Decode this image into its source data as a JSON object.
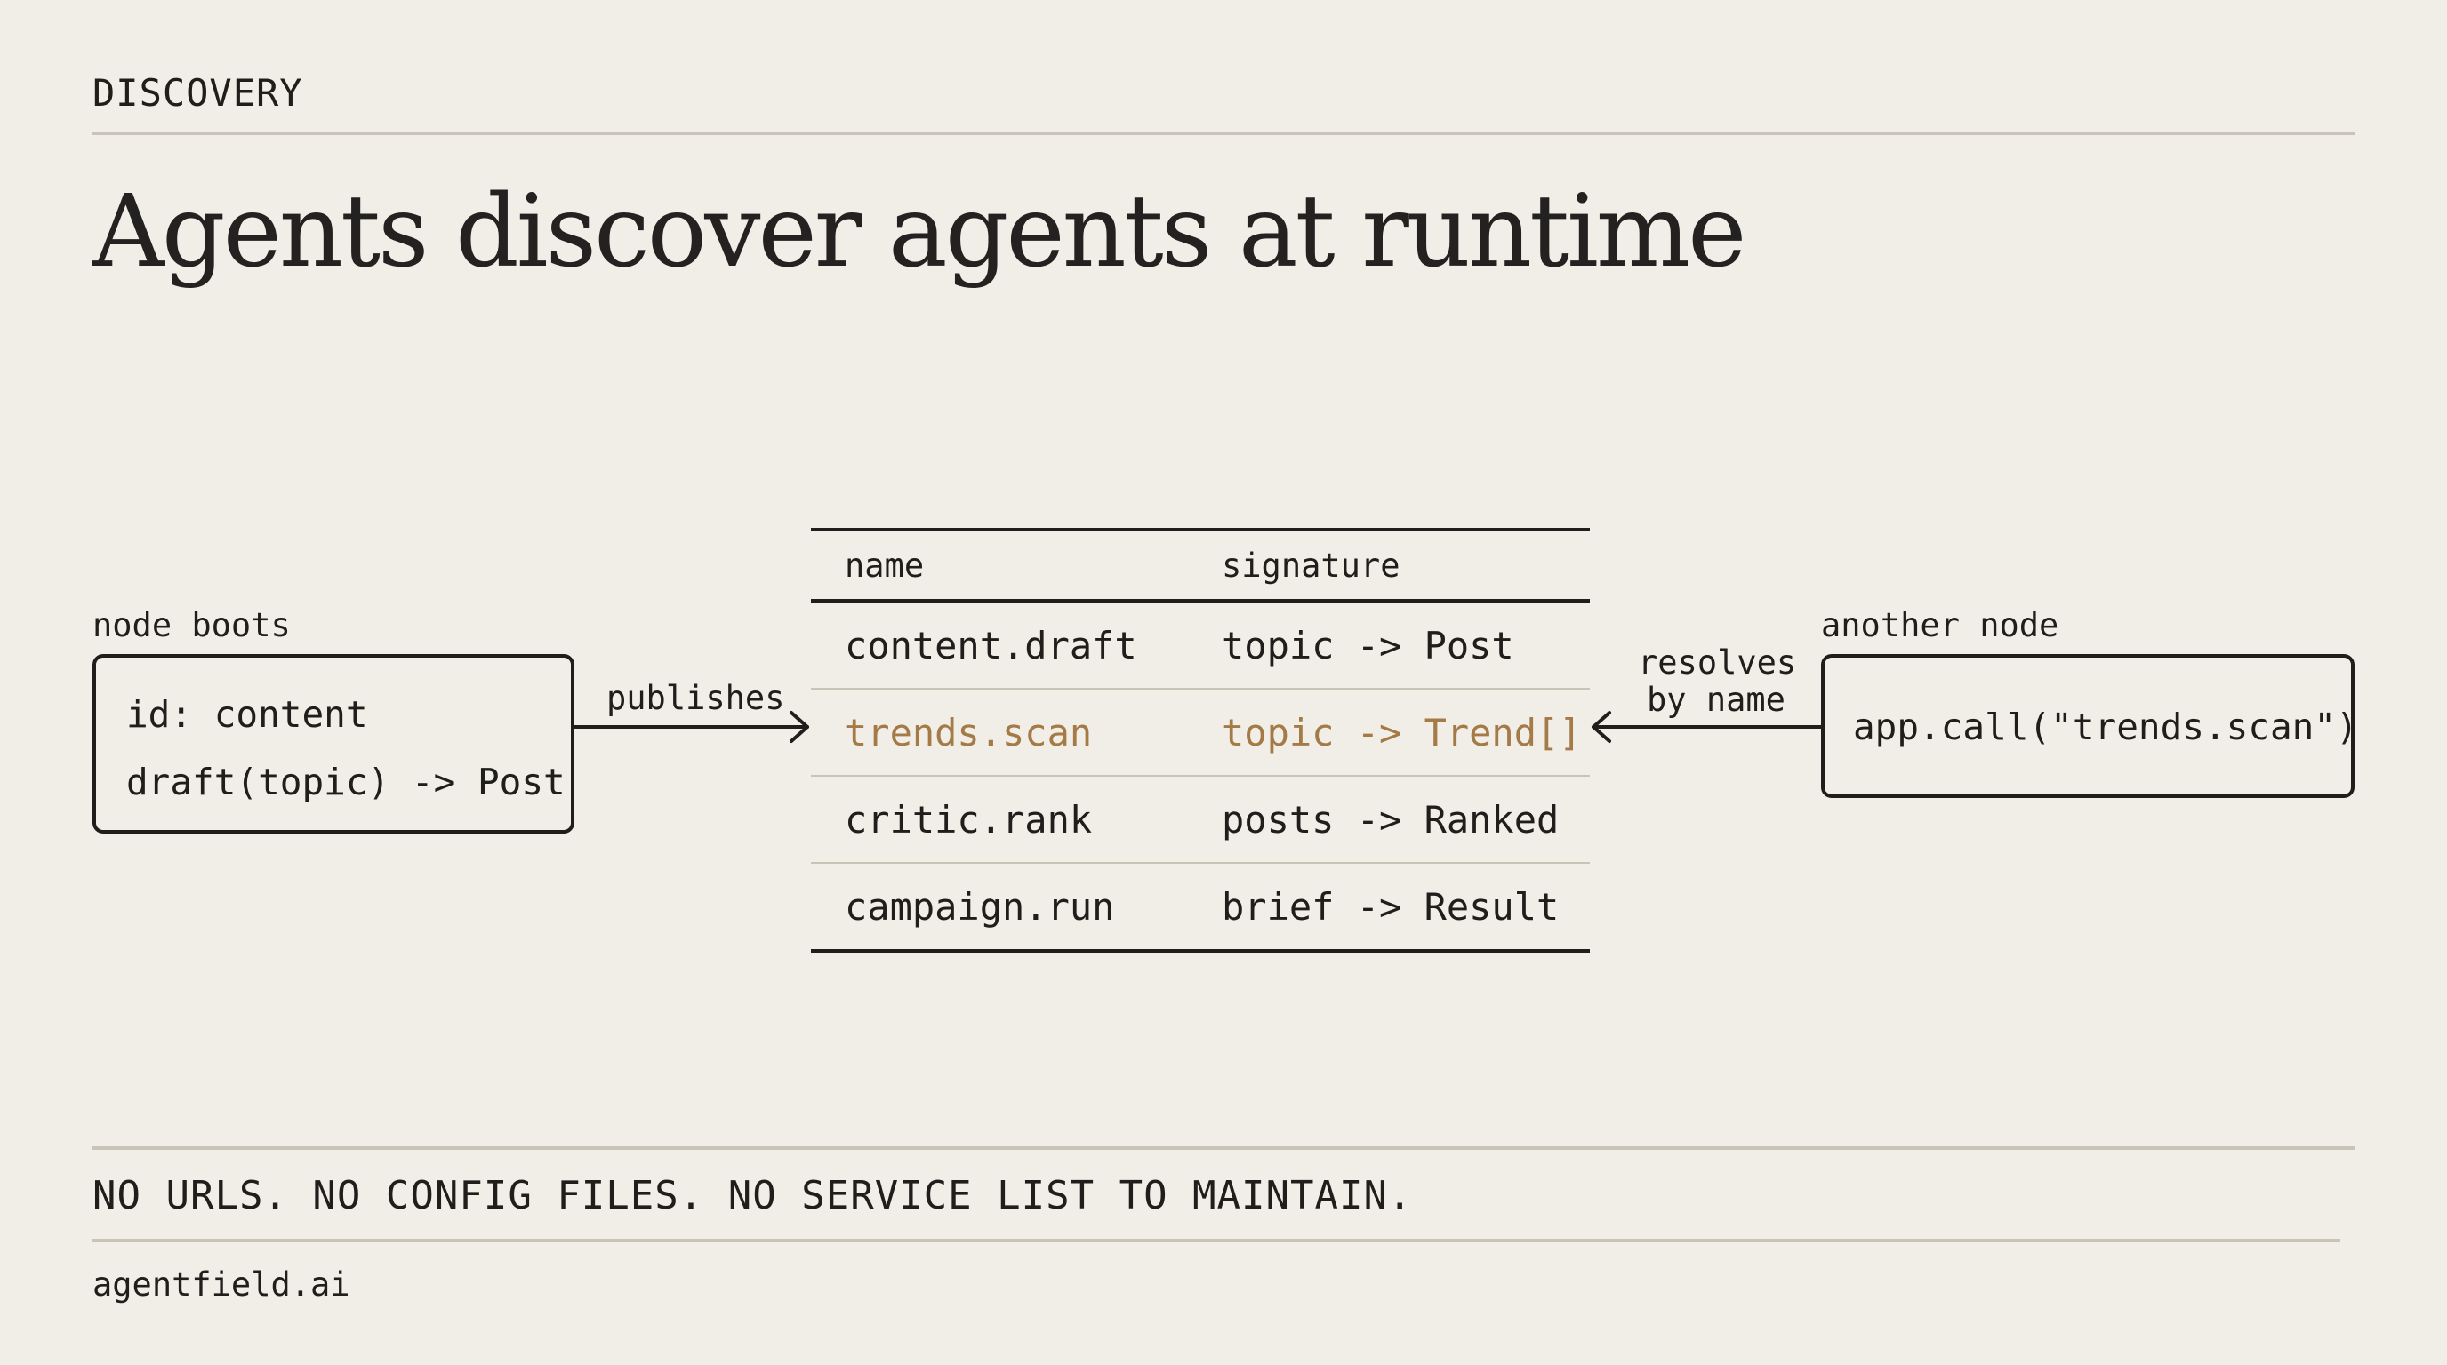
{
  "header": {
    "eyebrow": "DISCOVERY",
    "title": "Agents discover agents at runtime"
  },
  "left_node": {
    "caption": "node boots",
    "lines": [
      "id: content",
      "draft(topic) -> Post"
    ]
  },
  "publish_edge": {
    "label": "publishes"
  },
  "registry": {
    "columns": [
      "name",
      "signature"
    ],
    "rows": [
      {
        "name": "content.draft",
        "signature": "topic -> Post",
        "highlighted": false
      },
      {
        "name": "trends.scan",
        "signature": "topic -> Trend[]",
        "highlighted": true
      },
      {
        "name": "critic.rank",
        "signature": "posts -> Ranked",
        "highlighted": false
      },
      {
        "name": "campaign.run",
        "signature": "brief -> Result",
        "highlighted": false
      }
    ],
    "highlight_color": "#a47a46"
  },
  "resolve_edge": {
    "label_line1": "resolves",
    "label_line2": "by name"
  },
  "right_node": {
    "caption": "another node",
    "code": "app.call(\"trends.scan\")"
  },
  "footer": {
    "tagline": "NO URLS. NO CONFIG FILES. NO SERVICE LIST TO MAINTAIN.",
    "site": "agentfield.ai"
  }
}
